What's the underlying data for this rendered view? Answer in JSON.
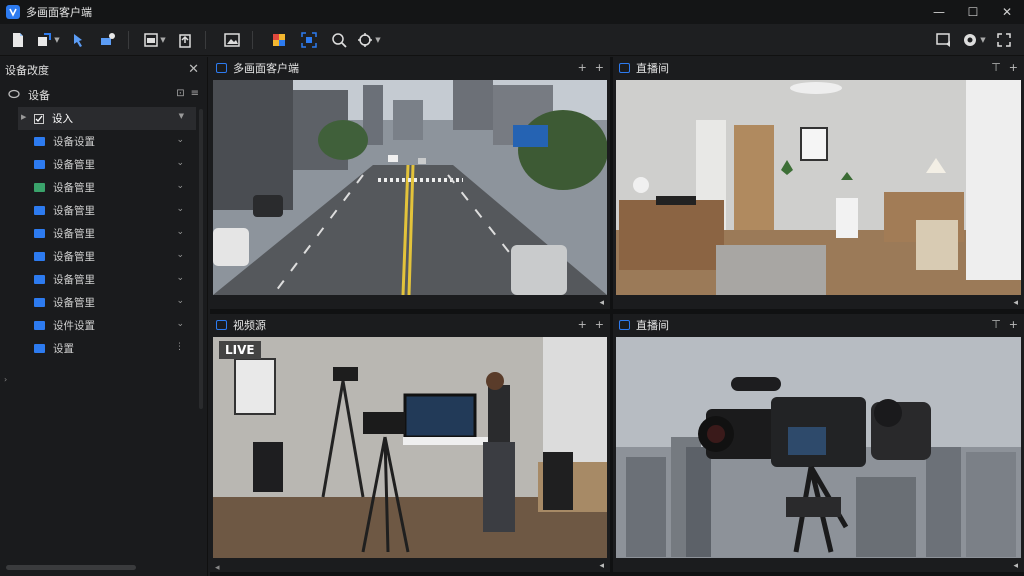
{
  "app": {
    "title": "多画面客户端"
  },
  "window_controls": {
    "minimize": "—",
    "maximize": "☐",
    "close": "✕"
  },
  "toolbar": {
    "left_icons": [
      "document-icon",
      "share-icon",
      "pin-icon",
      "camera-link-icon",
      "window-layout-icon",
      "clipboard-upload-icon",
      "image-icon",
      "plugin-icon",
      "screen-capture-icon",
      "zoom-icon",
      "ptz-control-icon"
    ],
    "right_icons": [
      "message-icon",
      "settings-icon",
      "fullscreen-icon"
    ]
  },
  "sidebar": {
    "title": "设备改度",
    "root_label": "设备",
    "items": [
      {
        "label": "设入",
        "selected": true
      },
      {
        "label": "设备设置"
      },
      {
        "label": "设备管里"
      },
      {
        "label": "设备管里"
      },
      {
        "label": "设备管里"
      },
      {
        "label": "设备管里"
      },
      {
        "label": "设备管里"
      },
      {
        "label": "设备管里"
      },
      {
        "label": "设备管里"
      },
      {
        "label": "设件设置"
      },
      {
        "label": "设置"
      }
    ]
  },
  "panes": [
    {
      "title": "多画面客户端",
      "scene": "street"
    },
    {
      "title": "直播间",
      "scene": "room"
    },
    {
      "title": "视频源",
      "scene": "studio",
      "badge": "LIVE"
    },
    {
      "title": "直播间",
      "scene": "camera"
    }
  ],
  "colors": {
    "accent": "#2d7bf0",
    "bg": "#1b1c1e",
    "titlebar": "#141516"
  }
}
